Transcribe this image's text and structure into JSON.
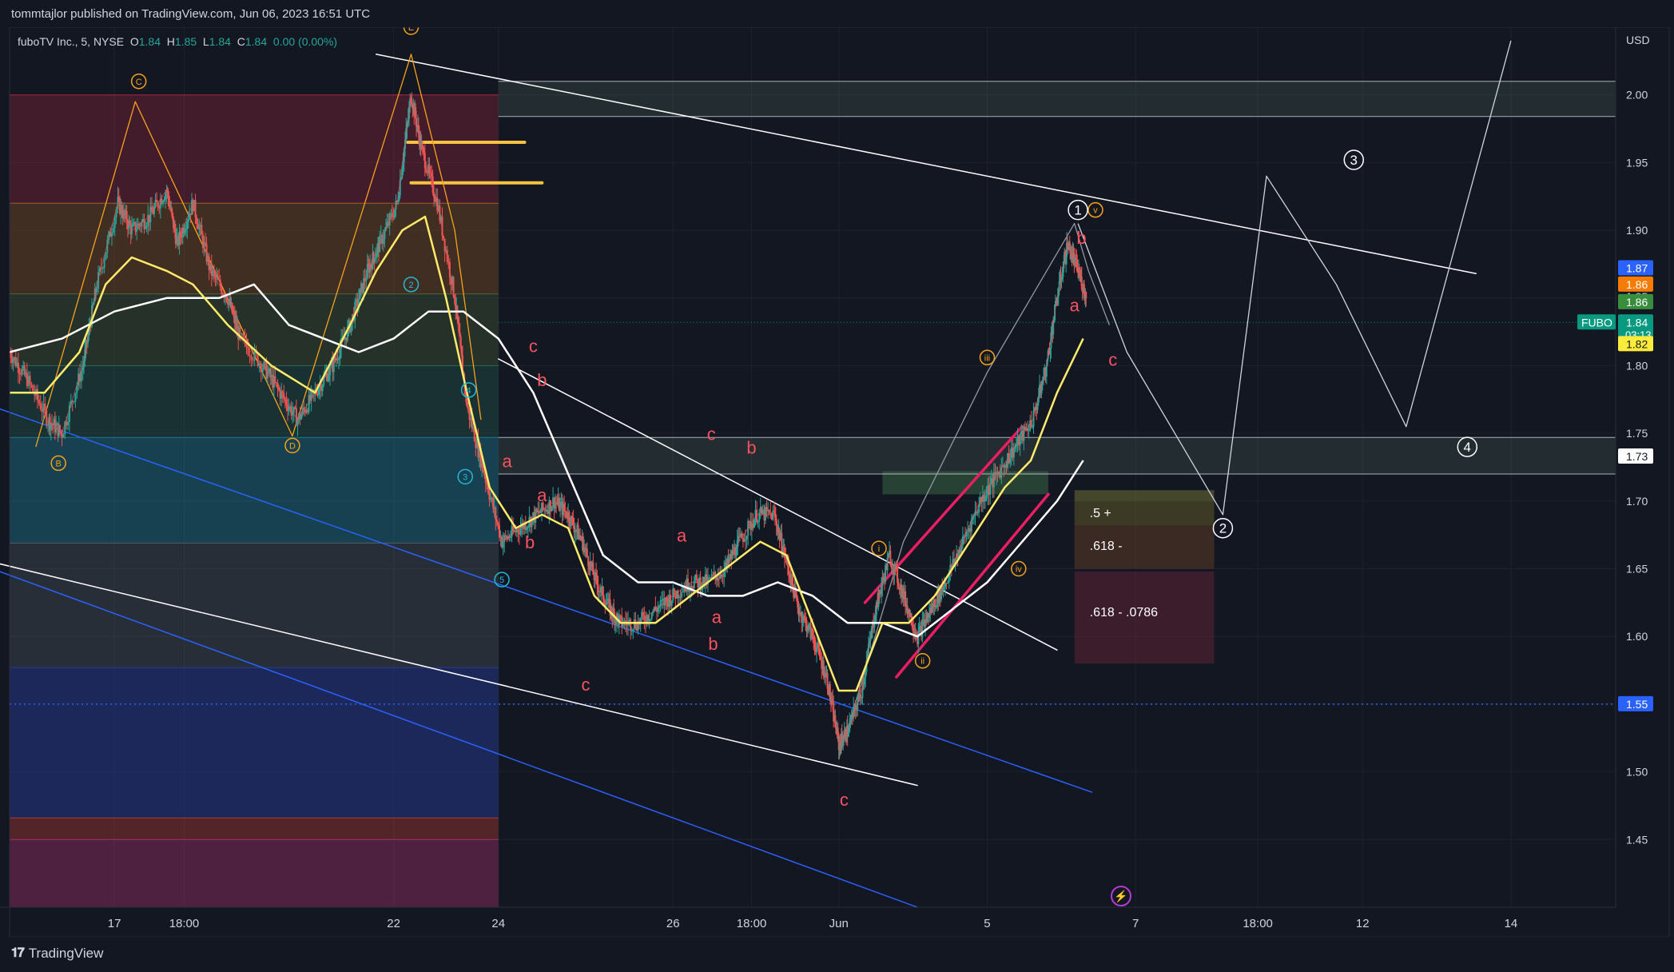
{
  "header": {
    "published": "tommtajlor published on TradingView.com, Jun 06, 2023 16:51 UTC"
  },
  "footer": {
    "brand": "TradingView",
    "brand_icon": "tradingview-logo-icon"
  },
  "legend": {
    "symbol": "fuboTV Inc., 5, NYSE",
    "o_label": "O",
    "o": "1.84",
    "h_label": "H",
    "h": "1.85",
    "l_label": "L",
    "l": "1.84",
    "c_label": "C",
    "c": "1.84",
    "change": "0.00 (0.00%)"
  },
  "colors": {
    "background": "#131722",
    "up": "#26a69a",
    "down": "#ef5350",
    "ma_yellow": "#ffeb69",
    "ma_white": "#ffffff",
    "wave_red": "#f7525f",
    "wave_orange": "#f7a21b",
    "channel_blue": "#2962ff",
    "trend_magenta": "#e91e63"
  },
  "chart_data": {
    "type": "line",
    "title": "",
    "currency": "USD",
    "y_ticks": [
      "2.00",
      "1.95",
      "1.90",
      "1.85",
      "1.80",
      "1.75",
      "1.70",
      "1.65",
      "1.60",
      "1.55",
      "1.50",
      "1.45"
    ],
    "x_ticks": [
      {
        "t": 0.6,
        "label": "17"
      },
      {
        "t": 1.0,
        "label": "18:00"
      },
      {
        "t": 2.2,
        "label": "22"
      },
      {
        "t": 2.8,
        "label": "24"
      },
      {
        "t": 3.8,
        "label": "26"
      },
      {
        "t": 4.25,
        "label": "18:00"
      },
      {
        "t": 4.75,
        "label": "Jun"
      },
      {
        "t": 5.6,
        "label": "5"
      },
      {
        "t": 6.45,
        "label": "7"
      },
      {
        "t": 7.15,
        "label": "18:00"
      },
      {
        "t": 7.75,
        "label": "12"
      },
      {
        "t": 8.6,
        "label": "14"
      }
    ],
    "price_tags": [
      {
        "label": "1.87",
        "value": 1.872,
        "color": "#2962ff",
        "text": "#ffffff"
      },
      {
        "label": "1.86",
        "value": 1.86,
        "color": "#f57c00",
        "text": "#ffffff"
      },
      {
        "label": "1.86",
        "value": 1.847,
        "color": "#388e3c",
        "text": "#ffffff"
      },
      {
        "label": "1.84",
        "value": 1.832,
        "color": "#089981",
        "text": "#ffffff",
        "sub": "03:13"
      },
      {
        "label": "1.82",
        "value": 1.816,
        "color": "#ffeb3b",
        "text": "#131722"
      },
      {
        "label": "1.73",
        "value": 1.733,
        "color": "#ffffff",
        "text": "#131722"
      },
      {
        "label": "1.55",
        "value": 1.55,
        "color": "#2962ff",
        "text": "#ffffff"
      }
    ],
    "symbol_tag": "FUBO",
    "partial_tick": "1.85",
    "fib_labels": [
      {
        "label": ".5 +",
        "t": 6.15,
        "v": 1.688
      },
      {
        "label": ".618 -",
        "t": 6.15,
        "v": 1.664
      },
      {
        "label": ".618 - .0786",
        "t": 6.15,
        "v": 1.615
      }
    ],
    "fib_bands": [
      {
        "v0": 2.0,
        "v1": 1.92,
        "color": "rgba(180,40,70,0.30)"
      },
      {
        "v0": 1.92,
        "v1": 1.853,
        "color": "rgba(170,100,40,0.30)"
      },
      {
        "v0": 1.853,
        "v1": 1.8,
        "color": "rgba(80,110,60,0.30)"
      },
      {
        "v0": 1.8,
        "v1": 1.747,
        "color": "rgba(40,110,90,0.30)"
      },
      {
        "v0": 1.747,
        "v1": 1.669,
        "color": "rgba(30,130,150,0.40)"
      },
      {
        "v0": 1.669,
        "v1": 1.577,
        "color": "rgba(90,100,110,0.30)"
      },
      {
        "v0": 1.577,
        "v1": 1.466,
        "color": "rgba(40,60,160,0.45)"
      },
      {
        "v0": 1.466,
        "v1": 1.45,
        "color": "rgba(180,60,50,0.40)"
      },
      {
        "v0": 1.45,
        "v1": 1.4,
        "color": "rgba(170,50,110,0.40)"
      }
    ],
    "price_path": [
      [
        0.0,
        1.81
      ],
      [
        0.1,
        1.79
      ],
      [
        0.22,
        1.76
      ],
      [
        0.3,
        1.75
      ],
      [
        0.42,
        1.8
      ],
      [
        0.5,
        1.86
      ],
      [
        0.62,
        1.92
      ],
      [
        0.7,
        1.9
      ],
      [
        0.8,
        1.91
      ],
      [
        0.9,
        1.93
      ],
      [
        0.96,
        1.89
      ],
      [
        1.05,
        1.92
      ],
      [
        1.15,
        1.87
      ],
      [
        1.25,
        1.85
      ],
      [
        1.32,
        1.82
      ],
      [
        1.45,
        1.8
      ],
      [
        1.55,
        1.78
      ],
      [
        1.65,
        1.76
      ],
      [
        1.75,
        1.78
      ],
      [
        1.85,
        1.8
      ],
      [
        1.95,
        1.83
      ],
      [
        2.05,
        1.87
      ],
      [
        2.12,
        1.89
      ],
      [
        2.22,
        1.92
      ],
      [
        2.3,
        2.0
      ],
      [
        2.36,
        1.96
      ],
      [
        2.45,
        1.92
      ],
      [
        2.55,
        1.85
      ],
      [
        2.62,
        1.77
      ],
      [
        2.72,
        1.72
      ],
      [
        2.82,
        1.67
      ],
      [
        2.92,
        1.68
      ],
      [
        3.02,
        1.69
      ],
      [
        3.12,
        1.7
      ],
      [
        3.2,
        1.69
      ],
      [
        3.28,
        1.67
      ],
      [
        3.36,
        1.64
      ],
      [
        3.44,
        1.62
      ],
      [
        3.5,
        1.61
      ],
      [
        3.6,
        1.61
      ],
      [
        3.7,
        1.62
      ],
      [
        3.8,
        1.63
      ],
      [
        3.9,
        1.64
      ],
      [
        4.0,
        1.64
      ],
      [
        4.1,
        1.65
      ],
      [
        4.18,
        1.67
      ],
      [
        4.28,
        1.69
      ],
      [
        4.38,
        1.69
      ],
      [
        4.44,
        1.66
      ],
      [
        4.52,
        1.62
      ],
      [
        4.6,
        1.6
      ],
      [
        4.68,
        1.57
      ],
      [
        4.75,
        1.52
      ],
      [
        4.8,
        1.53
      ],
      [
        4.88,
        1.56
      ],
      [
        4.96,
        1.62
      ],
      [
        5.04,
        1.66
      ],
      [
        5.12,
        1.63
      ],
      [
        5.2,
        1.6
      ],
      [
        5.28,
        1.62
      ],
      [
        5.36,
        1.64
      ],
      [
        5.46,
        1.67
      ],
      [
        5.56,
        1.7
      ],
      [
        5.66,
        1.72
      ],
      [
        5.76,
        1.74
      ],
      [
        5.86,
        1.76
      ],
      [
        5.94,
        1.8
      ],
      [
        6.0,
        1.85
      ],
      [
        6.06,
        1.89
      ],
      [
        6.12,
        1.87
      ],
      [
        6.17,
        1.85
      ]
    ],
    "ma_yellow": [
      [
        0.0,
        1.78
      ],
      [
        0.2,
        1.78
      ],
      [
        0.4,
        1.81
      ],
      [
        0.55,
        1.86
      ],
      [
        0.7,
        1.88
      ],
      [
        0.9,
        1.87
      ],
      [
        1.05,
        1.86
      ],
      [
        1.25,
        1.83
      ],
      [
        1.5,
        1.8
      ],
      [
        1.75,
        1.78
      ],
      [
        1.95,
        1.83
      ],
      [
        2.1,
        1.87
      ],
      [
        2.25,
        1.9
      ],
      [
        2.38,
        1.91
      ],
      [
        2.5,
        1.85
      ],
      [
        2.62,
        1.78
      ],
      [
        2.75,
        1.71
      ],
      [
        2.9,
        1.68
      ],
      [
        3.05,
        1.69
      ],
      [
        3.2,
        1.68
      ],
      [
        3.35,
        1.63
      ],
      [
        3.5,
        1.61
      ],
      [
        3.7,
        1.61
      ],
      [
        3.9,
        1.63
      ],
      [
        4.1,
        1.65
      ],
      [
        4.3,
        1.67
      ],
      [
        4.45,
        1.66
      ],
      [
        4.6,
        1.61
      ],
      [
        4.75,
        1.56
      ],
      [
        4.85,
        1.56
      ],
      [
        5.0,
        1.61
      ],
      [
        5.15,
        1.61
      ],
      [
        5.3,
        1.63
      ],
      [
        5.5,
        1.67
      ],
      [
        5.7,
        1.71
      ],
      [
        5.85,
        1.73
      ],
      [
        6.0,
        1.78
      ],
      [
        6.15,
        1.82
      ]
    ],
    "ma_white": [
      [
        0.0,
        1.81
      ],
      [
        0.3,
        1.82
      ],
      [
        0.6,
        1.84
      ],
      [
        0.9,
        1.85
      ],
      [
        1.2,
        1.85
      ],
      [
        1.4,
        1.86
      ],
      [
        1.6,
        1.83
      ],
      [
        1.8,
        1.82
      ],
      [
        2.0,
        1.81
      ],
      [
        2.2,
        1.82
      ],
      [
        2.4,
        1.84
      ],
      [
        2.6,
        1.84
      ],
      [
        2.8,
        1.82
      ],
      [
        3.0,
        1.78
      ],
      [
        3.2,
        1.72
      ],
      [
        3.4,
        1.66
      ],
      [
        3.6,
        1.64
      ],
      [
        3.8,
        1.64
      ],
      [
        4.0,
        1.63
      ],
      [
        4.2,
        1.63
      ],
      [
        4.4,
        1.64
      ],
      [
        4.6,
        1.63
      ],
      [
        4.8,
        1.61
      ],
      [
        5.0,
        1.61
      ],
      [
        5.2,
        1.6
      ],
      [
        5.4,
        1.62
      ],
      [
        5.6,
        1.64
      ],
      [
        5.8,
        1.67
      ],
      [
        6.0,
        1.7
      ],
      [
        6.15,
        1.73
      ]
    ],
    "wave_labels": [
      {
        "label": "c",
        "t": 3.0,
        "v": 1.81,
        "color": "#f7525f"
      },
      {
        "label": "b",
        "t": 3.05,
        "v": 1.785,
        "color": "#f7525f"
      },
      {
        "label": "a",
        "t": 2.85,
        "v": 1.725,
        "color": "#f7525f"
      },
      {
        "label": "a",
        "t": 3.05,
        "v": 1.7,
        "color": "#f7525f"
      },
      {
        "label": "b",
        "t": 2.98,
        "v": 1.665,
        "color": "#f7525f"
      },
      {
        "label": "c",
        "t": 3.3,
        "v": 1.56,
        "color": "#f7525f"
      },
      {
        "label": "a",
        "t": 3.85,
        "v": 1.67,
        "color": "#f7525f"
      },
      {
        "label": "c",
        "t": 4.02,
        "v": 1.745,
        "color": "#f7525f"
      },
      {
        "label": "b",
        "t": 4.25,
        "v": 1.735,
        "color": "#f7525f"
      },
      {
        "label": "a",
        "t": 4.05,
        "v": 1.61,
        "color": "#f7525f"
      },
      {
        "label": "b",
        "t": 4.03,
        "v": 1.59,
        "color": "#f7525f"
      },
      {
        "label": "c",
        "t": 4.78,
        "v": 1.475,
        "color": "#f7525f"
      },
      {
        "label": "b",
        "t": 6.14,
        "v": 1.89,
        "color": "#f7525f"
      },
      {
        "label": "a",
        "t": 6.1,
        "v": 1.84,
        "color": "#f7525f"
      },
      {
        "label": "c",
        "t": 6.32,
        "v": 1.8,
        "color": "#f7525f"
      }
    ],
    "circle_labels": [
      {
        "label": "i",
        "t": 4.98,
        "v": 1.665,
        "color": "#f7a21b"
      },
      {
        "label": "ii",
        "t": 5.23,
        "v": 1.582,
        "color": "#f7a21b"
      },
      {
        "label": "iii",
        "t": 5.6,
        "v": 1.806,
        "color": "#f7a21b"
      },
      {
        "label": "iv",
        "t": 5.78,
        "v": 1.65,
        "color": "#f7a21b"
      },
      {
        "label": "v",
        "t": 6.22,
        "v": 1.915,
        "color": "#f7a21b"
      },
      {
        "label": "C",
        "t": 0.74,
        "v": 2.01,
        "color": "#f7a21b"
      },
      {
        "label": "B",
        "t": 0.28,
        "v": 1.728,
        "color": "#f7a21b"
      },
      {
        "label": "D",
        "t": 1.62,
        "v": 1.741,
        "color": "#f7a21b"
      },
      {
        "label": "E",
        "t": 2.3,
        "v": 2.05,
        "color": "#f7a21b"
      },
      {
        "label": "4",
        "t": 2.63,
        "v": 1.782,
        "color": "#22b8d6"
      },
      {
        "label": "3",
        "t": 2.61,
        "v": 1.718,
        "color": "#22b8d6"
      },
      {
        "label": "5",
        "t": 2.82,
        "v": 1.642,
        "color": "#22b8d6"
      },
      {
        "label": "2",
        "t": 2.3,
        "v": 1.86,
        "color": "#22b8d6"
      },
      {
        "label": "1",
        "t": 6.12,
        "v": 1.915,
        "color": "#ffffff"
      },
      {
        "label": "2",
        "t": 6.95,
        "v": 1.68,
        "color": "#ffffff"
      },
      {
        "label": "3",
        "t": 7.7,
        "v": 1.952,
        "color": "#ffffff"
      },
      {
        "label": "4",
        "t": 8.35,
        "v": 1.74,
        "color": "#ffffff"
      }
    ],
    "projection": [
      [
        6.12,
        1.905
      ],
      [
        6.4,
        1.81
      ],
      [
        6.95,
        1.69
      ],
      [
        7.2,
        1.94
      ],
      [
        7.6,
        1.86
      ],
      [
        8.0,
        1.755
      ],
      [
        8.6,
        2.04
      ]
    ],
    "trendlines": [
      {
        "p": [
          [
            2.1,
            2.03
          ],
          [
            8.4,
            1.868
          ]
        ],
        "color": "#ffffff",
        "w": 1.5
      },
      {
        "p": [
          [
            2.8,
            1.805
          ],
          [
            6.0,
            1.59
          ]
        ],
        "color": "#ffffff",
        "w": 1.5
      },
      {
        "p": [
          [
            -0.1,
            1.655
          ],
          [
            5.2,
            1.49
          ]
        ],
        "color": "#ffffff",
        "w": 1.5
      },
      {
        "p": [
          [
            -0.1,
            1.77
          ],
          [
            6.2,
            1.485
          ]
        ],
        "color": "#2962ff",
        "w": 1.5
      },
      {
        "p": [
          [
            -0.1,
            1.65
          ],
          [
            5.2,
            1.4
          ]
        ],
        "color": "#2962ff",
        "w": 1.5
      },
      {
        "p": [
          [
            4.9,
            1.625
          ],
          [
            5.8,
            1.755
          ]
        ],
        "color": "#e91e63",
        "w": 3.5
      },
      {
        "p": [
          [
            5.08,
            1.57
          ],
          [
            5.95,
            1.705
          ]
        ],
        "color": "#e91e63",
        "w": 3.5
      }
    ],
    "yellow_marks": [
      {
        "p": [
          [
            2.28,
            1.965
          ],
          [
            2.95,
            1.965
          ]
        ]
      },
      {
        "p": [
          [
            2.3,
            1.935
          ],
          [
            3.05,
            1.935
          ]
        ]
      }
    ],
    "orange_waves": [
      [
        0.15,
        1.74
      ],
      [
        0.72,
        1.995
      ],
      [
        1.62,
        1.748
      ],
      [
        2.3,
        2.03
      ],
      [
        2.55,
        1.9
      ],
      [
        2.7,
        1.76
      ]
    ],
    "grey_waves": [
      [
        4.75,
        1.51
      ],
      [
        5.12,
        1.67
      ],
      [
        5.6,
        1.795
      ],
      [
        6.1,
        1.905
      ],
      [
        6.18,
        1.87
      ],
      [
        6.3,
        1.83
      ]
    ],
    "hzones": [
      {
        "v0": 2.01,
        "v1": 1.984,
        "t0": 2.8,
        "t1": 9.3,
        "color": "rgba(110,150,120,0.18)"
      },
      {
        "v0": 1.747,
        "v1": 1.72,
        "t0": 2.8,
        "t1": 9.3,
        "color": "rgba(110,150,120,0.18)"
      },
      {
        "v0": 1.722,
        "v1": 1.705,
        "t0": 5.0,
        "t1": 5.95,
        "color": "rgba(70,130,80,0.40)"
      },
      {
        "v0": 1.708,
        "v1": 1.7,
        "t0": 6.1,
        "t1": 6.9,
        "color": "rgba(160,160,60,0.35)"
      },
      {
        "v0": 1.7,
        "v1": 1.682,
        "t0": 6.1,
        "t1": 6.9,
        "color": "rgba(110,100,40,0.45)"
      },
      {
        "v0": 1.682,
        "v1": 1.65,
        "t0": 6.1,
        "t1": 6.9,
        "color": "rgba(120,70,40,0.40)"
      },
      {
        "v0": 1.648,
        "v1": 1.58,
        "t0": 6.1,
        "t1": 6.9,
        "color": "rgba(120,40,60,0.40)"
      }
    ],
    "dotted_line": {
      "v": 1.55,
      "color": "#2962ff"
    },
    "t_range": [
      0,
      9.2
    ],
    "ylim": [
      1.4,
      2.05
    ]
  }
}
